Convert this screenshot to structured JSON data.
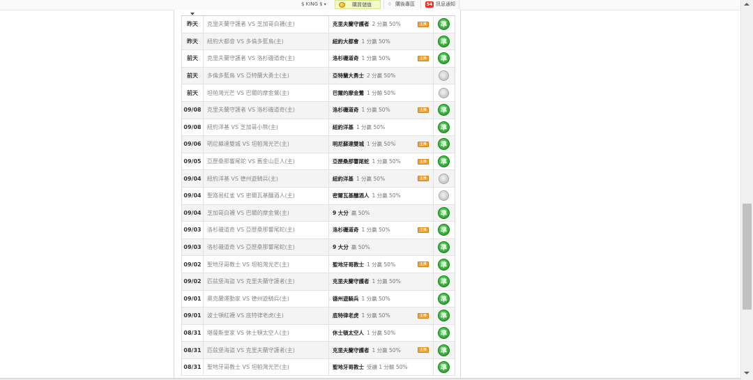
{
  "topbar": {
    "user": "$ KING $",
    "user_caret": "▾",
    "buy_label": "購買儲值",
    "archive_count": "0",
    "archive_label": "購後專區",
    "msg_count": "54",
    "msg_label": "訊息通知"
  },
  "colors": {
    "win": "#1e9a1e",
    "pending": "#b9b9b9",
    "tag": "#f0a030",
    "alt_row": "#f4f4f4"
  },
  "icons": {
    "win": "green-circle-win-icon",
    "pending": "gray-circle-pending-icon",
    "tag": "orange-tag-icon"
  },
  "rows": [
    {
      "date": "昨天",
      "match": "克里夫蘭守護者 VS 芝加哥白襪(主)",
      "team": "克里夫蘭守護者",
      "odds": "2 分贏 50%",
      "tag": "主推",
      "result": "準"
    },
    {
      "date": "昨天",
      "match": "紐約大都會 VS 多倫多藍鳥(主)",
      "team": "紐約大都會",
      "odds": "1 分贏 50%",
      "tag": "",
      "result": "準"
    },
    {
      "date": "前天",
      "match": "克里夫蘭守護者 VS 洛杉磯道奇(主)",
      "team": "洛杉磯道奇",
      "odds": "1 分贏 50%",
      "tag": "主推",
      "result": "準"
    },
    {
      "date": "前天",
      "match": "多倫多藍鳥 VS 亞特蘭大勇士(主)",
      "team": "亞特蘭大勇士",
      "odds": "2 分贏 50%",
      "tag": "",
      "result": "pending"
    },
    {
      "date": "前天",
      "match": "坦帕灣光芒 VS 巴爾的摩金鶯(主)",
      "team": "巴爾的摩金鶯",
      "odds": "1 分輸 50%",
      "tag": "",
      "result": "pending"
    },
    {
      "date": "09/08",
      "match": "克里夫蘭守護者 VS 洛杉磯道奇(主)",
      "team": "洛杉磯道奇",
      "odds": "1 分贏 50%",
      "tag": "主推",
      "result": "準"
    },
    {
      "date": "09/08",
      "match": "紐約洋基 VS 芝加哥小熊(主)",
      "team": "紐約洋基",
      "odds": "1 分贏 50%",
      "tag": "",
      "result": "準"
    },
    {
      "date": "09/06",
      "match": "明尼蘇達雙城 VS 坦帕灣光芒(主)",
      "team": "明尼蘇達雙城",
      "odds": "1 分贏 50%",
      "tag": "主推",
      "result": "準"
    },
    {
      "date": "09/05",
      "match": "亞歷桑那響尾蛇 VS 舊金山巨人(主)",
      "team": "亞歷桑那響尾蛇",
      "odds": "1 分贏 50%",
      "tag": "主推",
      "result": "準"
    },
    {
      "date": "09/04",
      "match": "紐約洋基 VS 德州遊騎兵(主)",
      "team": "紐約洋基",
      "odds": "1 分贏 50%",
      "tag": "主推",
      "result": "pending"
    },
    {
      "date": "09/04",
      "match": "聖路易紅雀 VS 密爾瓦基釀酒人(主)",
      "team": "密爾瓦基釀酒人",
      "odds": "1 分贏 50%",
      "tag": "",
      "result": "pending"
    },
    {
      "date": "09/04",
      "match": "芝加哥白襪 VS 巴爾的摩金鶯(主)",
      "team": "9 大分",
      "odds": "贏 50%",
      "tag": "",
      "result": "準"
    },
    {
      "date": "09/03",
      "match": "洛杉磯道奇 VS 亞歷桑那響尾蛇(主)",
      "team": "洛杉磯道奇",
      "odds": "1 分贏 50%",
      "tag": "主推",
      "result": "準"
    },
    {
      "date": "09/03",
      "match": "洛杉磯道奇 VS 亞歷桑那響尾蛇(主)",
      "team": "9 大分",
      "odds": "贏 50%",
      "tag": "",
      "result": "準"
    },
    {
      "date": "09/02",
      "match": "聖地牙哥教士 VS 坦帕灣光芒(主)",
      "team": "聖地牙哥教士",
      "odds": "1 分贏 50%",
      "tag": "主推",
      "result": "準"
    },
    {
      "date": "09/02",
      "match": "匹茲堡海盜 VS 克里夫蘭守護者(主)",
      "team": "克里夫蘭守護者",
      "odds": "1 分贏 50%",
      "tag": "",
      "result": "準"
    },
    {
      "date": "09/01",
      "match": "奧克蘭運動家 VS 德州遊騎兵(主)",
      "team": "德州遊騎兵",
      "odds": "1 分贏 50%",
      "tag": "",
      "result": "準"
    },
    {
      "date": "09/01",
      "match": "波士頓紅襪 VS 底特律老虎(主)",
      "team": "底特律老虎",
      "odds": "1 分贏 50%",
      "tag": "主推",
      "result": "準"
    },
    {
      "date": "08/31",
      "match": "堪薩斯皇家 VS 休士頓太空人(主)",
      "team": "休士頓太空人",
      "odds": "1 分贏 50%",
      "tag": "",
      "result": "準"
    },
    {
      "date": "08/31",
      "match": "匹茲堡海盜 VS 克里夫蘭守護者(主)",
      "team": "克里夫蘭守護者",
      "odds": "1 分贏 50%",
      "tag": "主推",
      "result": "準"
    },
    {
      "date": "08/31",
      "match": "聖地牙哥教士 VS 坦帕灣光芒(主)",
      "team": "聖地牙哥教士",
      "odds": "受讓 1 分輸 50%",
      "tag": "",
      "result": "準"
    }
  ]
}
